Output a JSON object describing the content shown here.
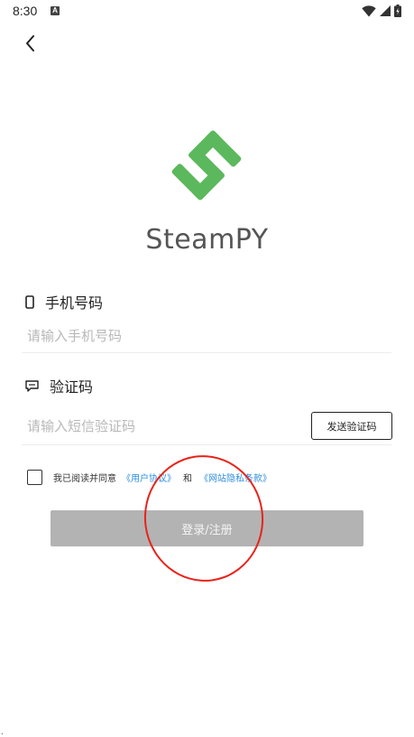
{
  "status_bar": {
    "time": "8:30",
    "notification_letter": "A",
    "icons": [
      "wifi-icon",
      "signal-icon",
      "battery-icon"
    ]
  },
  "app": {
    "name": "SteamPY",
    "brand_color": "#5cb85c"
  },
  "phone": {
    "label": "手机号码",
    "icon": "phone-icon",
    "placeholder": "请输入手机号码",
    "value": ""
  },
  "code": {
    "label": "验证码",
    "icon": "message-icon",
    "placeholder": "请输入短信验证码",
    "value": "",
    "send_label": "发送验证码"
  },
  "agreement": {
    "checked": false,
    "text": "我已阅读并同意",
    "user_agreement": "《用户协议》",
    "and": "和",
    "privacy_policy": "《网站隐私条款》",
    "link_color": "#2f8fe0"
  },
  "login": {
    "label": "登录/注册",
    "button_color": "#b3b3b3"
  },
  "annotation": {
    "color": "#e8231a"
  }
}
